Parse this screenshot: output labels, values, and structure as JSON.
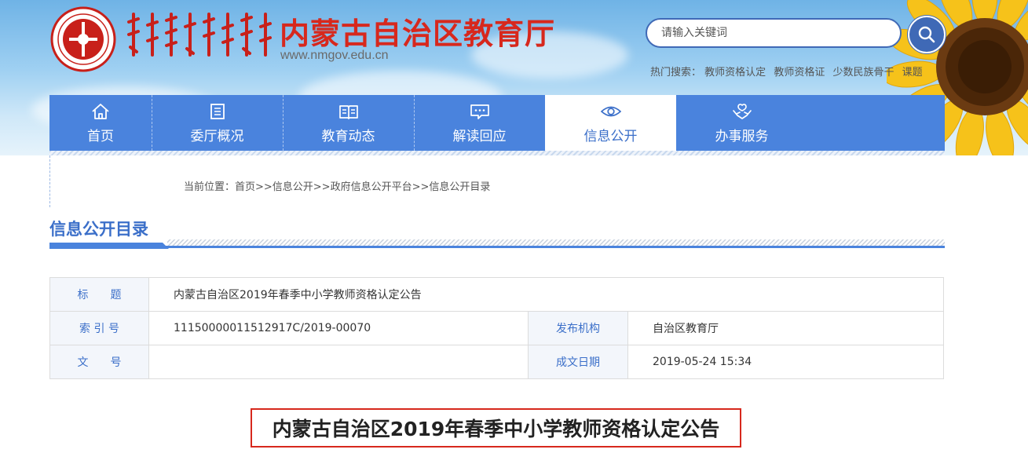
{
  "header": {
    "site_title": "内蒙古自治区教育厅",
    "site_url": "www.nmgov.edu.cn",
    "search": {
      "placeholder": "请输入关键词"
    },
    "hot_search": {
      "label": "热门搜索：",
      "terms": [
        "教师资格认定",
        "教师资格证",
        "少数民族骨干",
        "课题"
      ]
    }
  },
  "nav": {
    "items": [
      {
        "label": "首页",
        "icon": "home-icon"
      },
      {
        "label": "委厅概况",
        "icon": "list-icon"
      },
      {
        "label": "教育动态",
        "icon": "book-icon"
      },
      {
        "label": "解读回应",
        "icon": "chat-bubble-icon"
      },
      {
        "label": "信息公开",
        "icon": "eye-icon",
        "active": true
      },
      {
        "label": "办事服务",
        "icon": "hands-service-icon"
      }
    ]
  },
  "breadcrumb": {
    "text": "当前位置：首页>>信息公开>>政府信息公开平台>>信息公开目录"
  },
  "section": {
    "title": "信息公开目录"
  },
  "meta": {
    "title_label": "标　　题",
    "title_value": "内蒙古自治区2019年春季中小学教师资格认定公告",
    "index_label": "索 引 号",
    "index_value": "11150000011512917C/2019-00070",
    "publisher_label": "发布机构",
    "publisher_value": "自治区教育厅",
    "docno_label": "文　　号",
    "docno_value": "",
    "date_label": "成文日期",
    "date_value": "2019-05-24 15:34"
  },
  "article": {
    "title": "内蒙古自治区2019年春季中小学教师资格认定公告"
  },
  "colors": {
    "nav_blue": "#4a83dd",
    "accent_blue": "#3b6fc9",
    "title_red": "#d7281d"
  }
}
